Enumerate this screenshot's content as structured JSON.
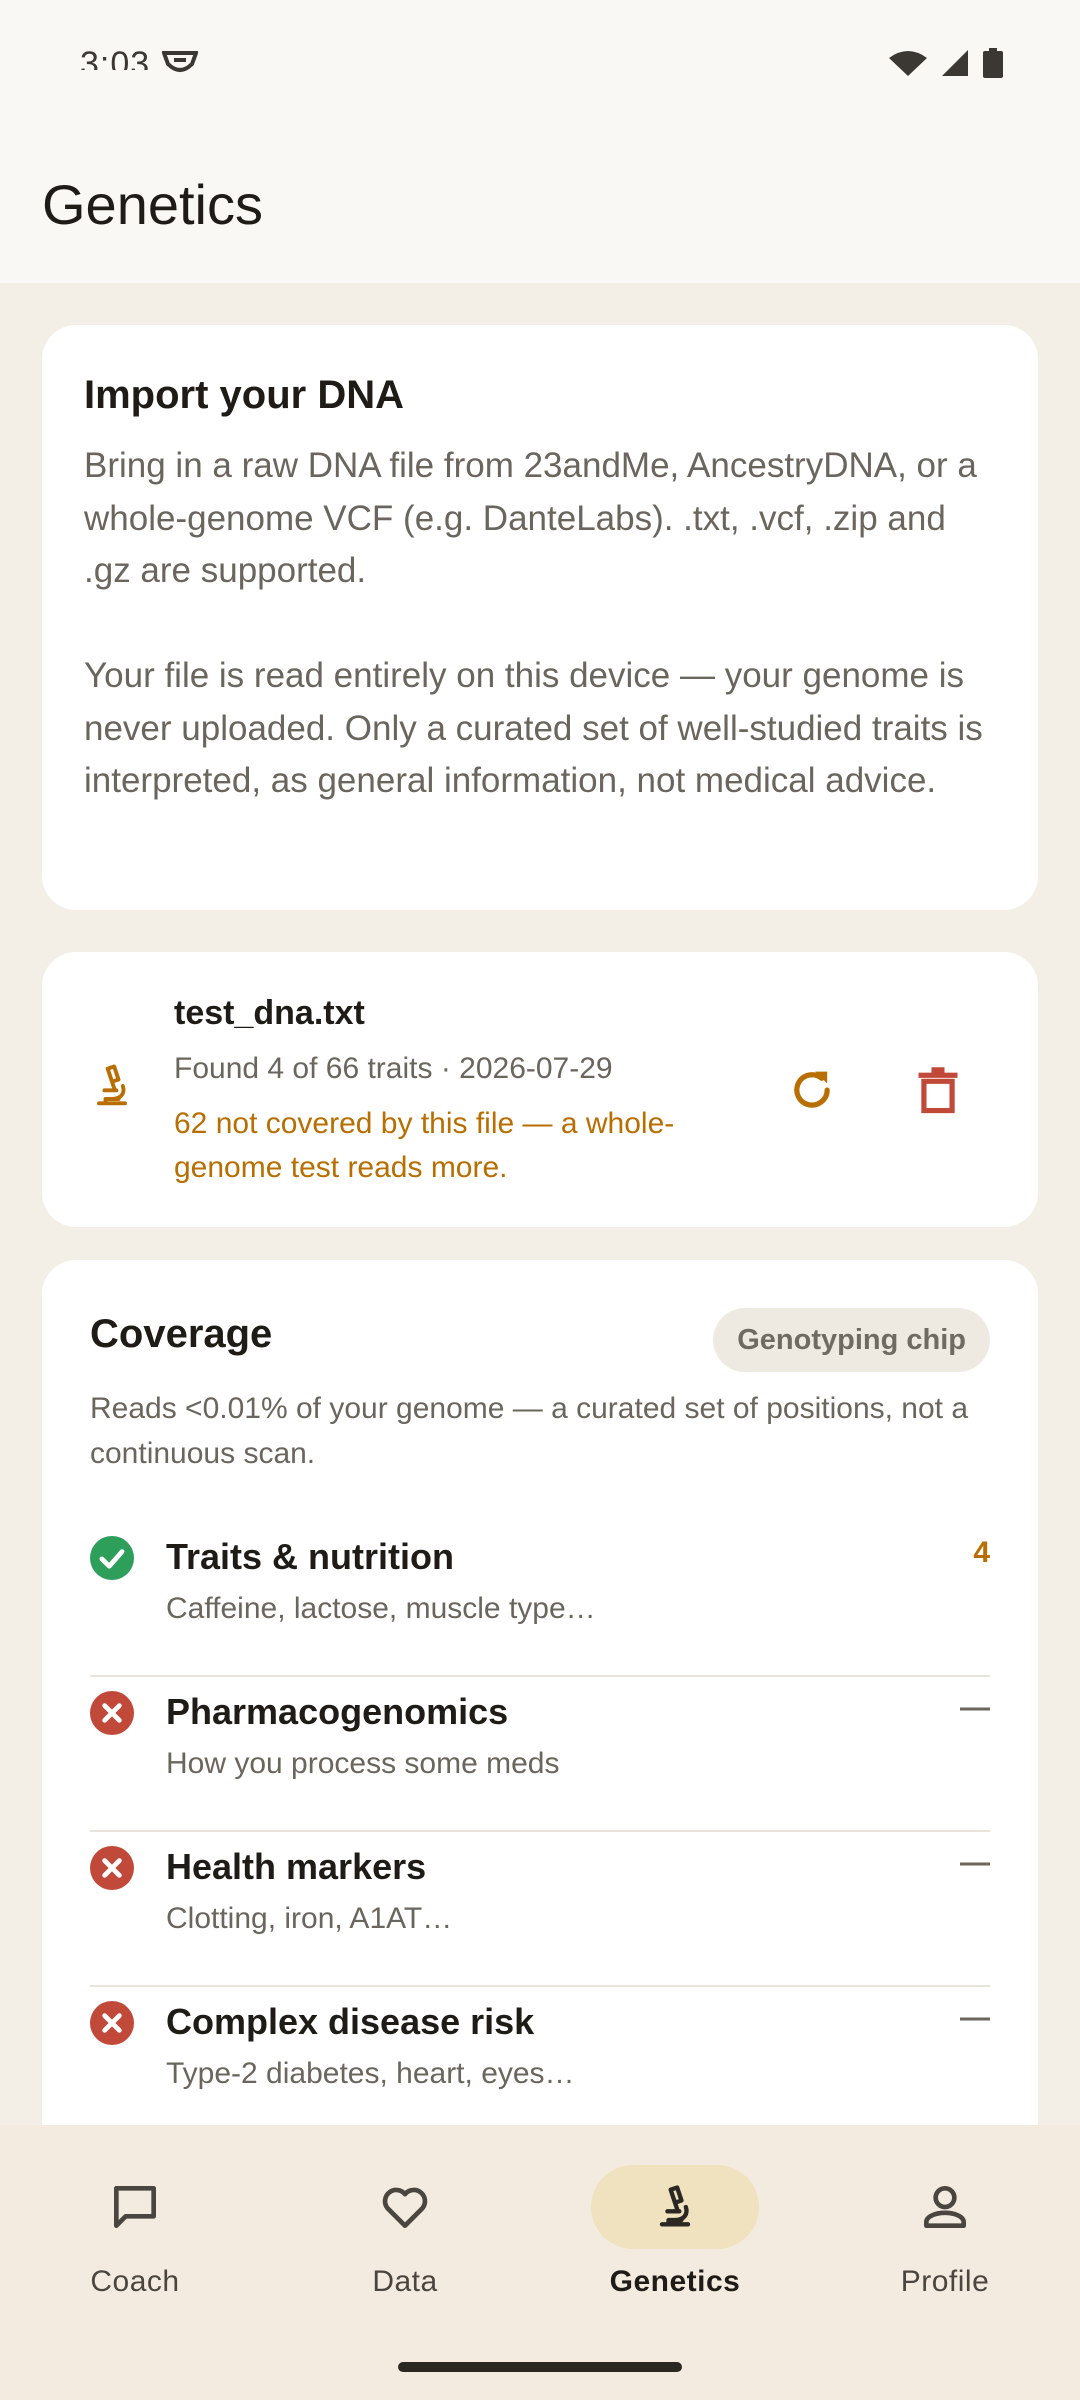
{
  "status_bar": {
    "time": "3:03"
  },
  "app_bar": {
    "title": "Genetics"
  },
  "import_card": {
    "heading": "Import your DNA",
    "body": "Bring in a raw DNA file from 23andMe, AncestryDNA, or a whole-genome VCF (e.g. DanteLabs). .txt, .vcf, .zip and .gz are supported.\n\nYour file is read entirely on this device — your genome is never uploaded. Only a curated set of well-studied traits is interpreted, as general information, not medical advice."
  },
  "file_card": {
    "file_name": "test_dna.txt",
    "meta": "Found 4 of 66 traits · 2026-07-29",
    "warning": "62 not covered by this file — a whole-genome test reads more.",
    "icon": "microscope-icon",
    "actions": [
      "refresh-icon",
      "trash-icon"
    ]
  },
  "coverage": {
    "title": "Coverage",
    "chip": "Genotyping chip",
    "subtitle": "Reads <0.01% of your genome — a curated set of positions, not a continuous scan.",
    "rows": [
      {
        "title": "Traits & nutrition",
        "subtitle": "Caffeine, lactose, muscle type…",
        "value": "4",
        "status": "covered"
      },
      {
        "title": "Pharmacogenomics",
        "subtitle": "How you process some meds",
        "value": "—",
        "status": "not-covered"
      },
      {
        "title": "Health markers",
        "subtitle": "Clotting, iron, A1AT…",
        "value": "—",
        "status": "not-covered"
      },
      {
        "title": "Complex disease risk",
        "subtitle": "Type-2 diabetes, heart, eyes…",
        "value": "—",
        "status": "not-covered"
      }
    ]
  },
  "nav": {
    "items": [
      {
        "label": "Coach",
        "icon": "chat-bubble-icon"
      },
      {
        "label": "Data",
        "icon": "heart-icon"
      },
      {
        "label": "Genetics",
        "icon": "microscope-icon",
        "active": true
      },
      {
        "label": "Profile",
        "icon": "person-icon"
      }
    ]
  },
  "colors": {
    "accent": "#b86e00",
    "success": "#2e9e5b",
    "error": "#c0493a",
    "background": "#f3efe7",
    "nav_active": "#f0e2bf"
  }
}
